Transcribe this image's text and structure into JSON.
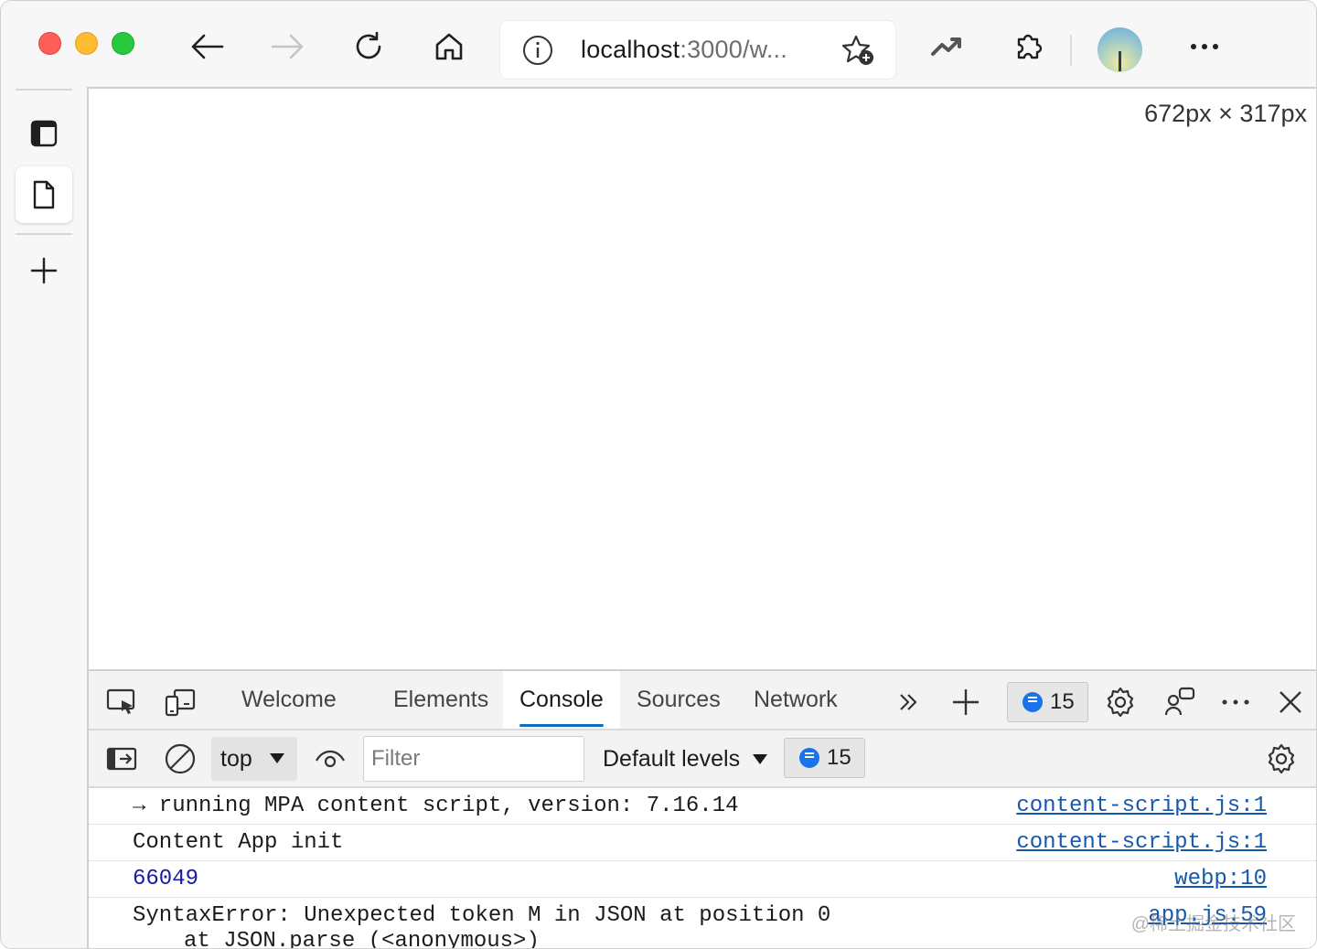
{
  "browser": {
    "address": {
      "host": "localhost",
      "rest": ":3000/w..."
    },
    "profile_avatar": "avatar-landscape"
  },
  "viewport": {
    "dimensions_label": "672px × 317px"
  },
  "devtools": {
    "tabs": [
      {
        "label": "Welcome"
      },
      {
        "label": "Elements"
      },
      {
        "label": "Console"
      },
      {
        "label": "Sources"
      },
      {
        "label": "Network"
      }
    ],
    "issues_count": "15",
    "filterbar": {
      "context": "top",
      "filter_placeholder": "Filter",
      "levels": "Default levels",
      "messages_count": "15"
    },
    "console_rows": [
      {
        "message": "→ running MPA content script, version: 7.16.14",
        "source": "content-script.js:1"
      },
      {
        "message": "Content App init",
        "source": "content-script.js:1"
      },
      {
        "message": "66049",
        "source": "webp:10"
      },
      {
        "message": "SyntaxError: Unexpected token M in JSON at position 0",
        "stack": "at JSON.parse (<anonymous>)",
        "source": "app.js:59"
      }
    ],
    "watermark": "@稀土掘金技术社区"
  },
  "colors": {
    "accent": "#0f6cbd",
    "link": "#1558b0",
    "number": "#1a1aa6"
  }
}
